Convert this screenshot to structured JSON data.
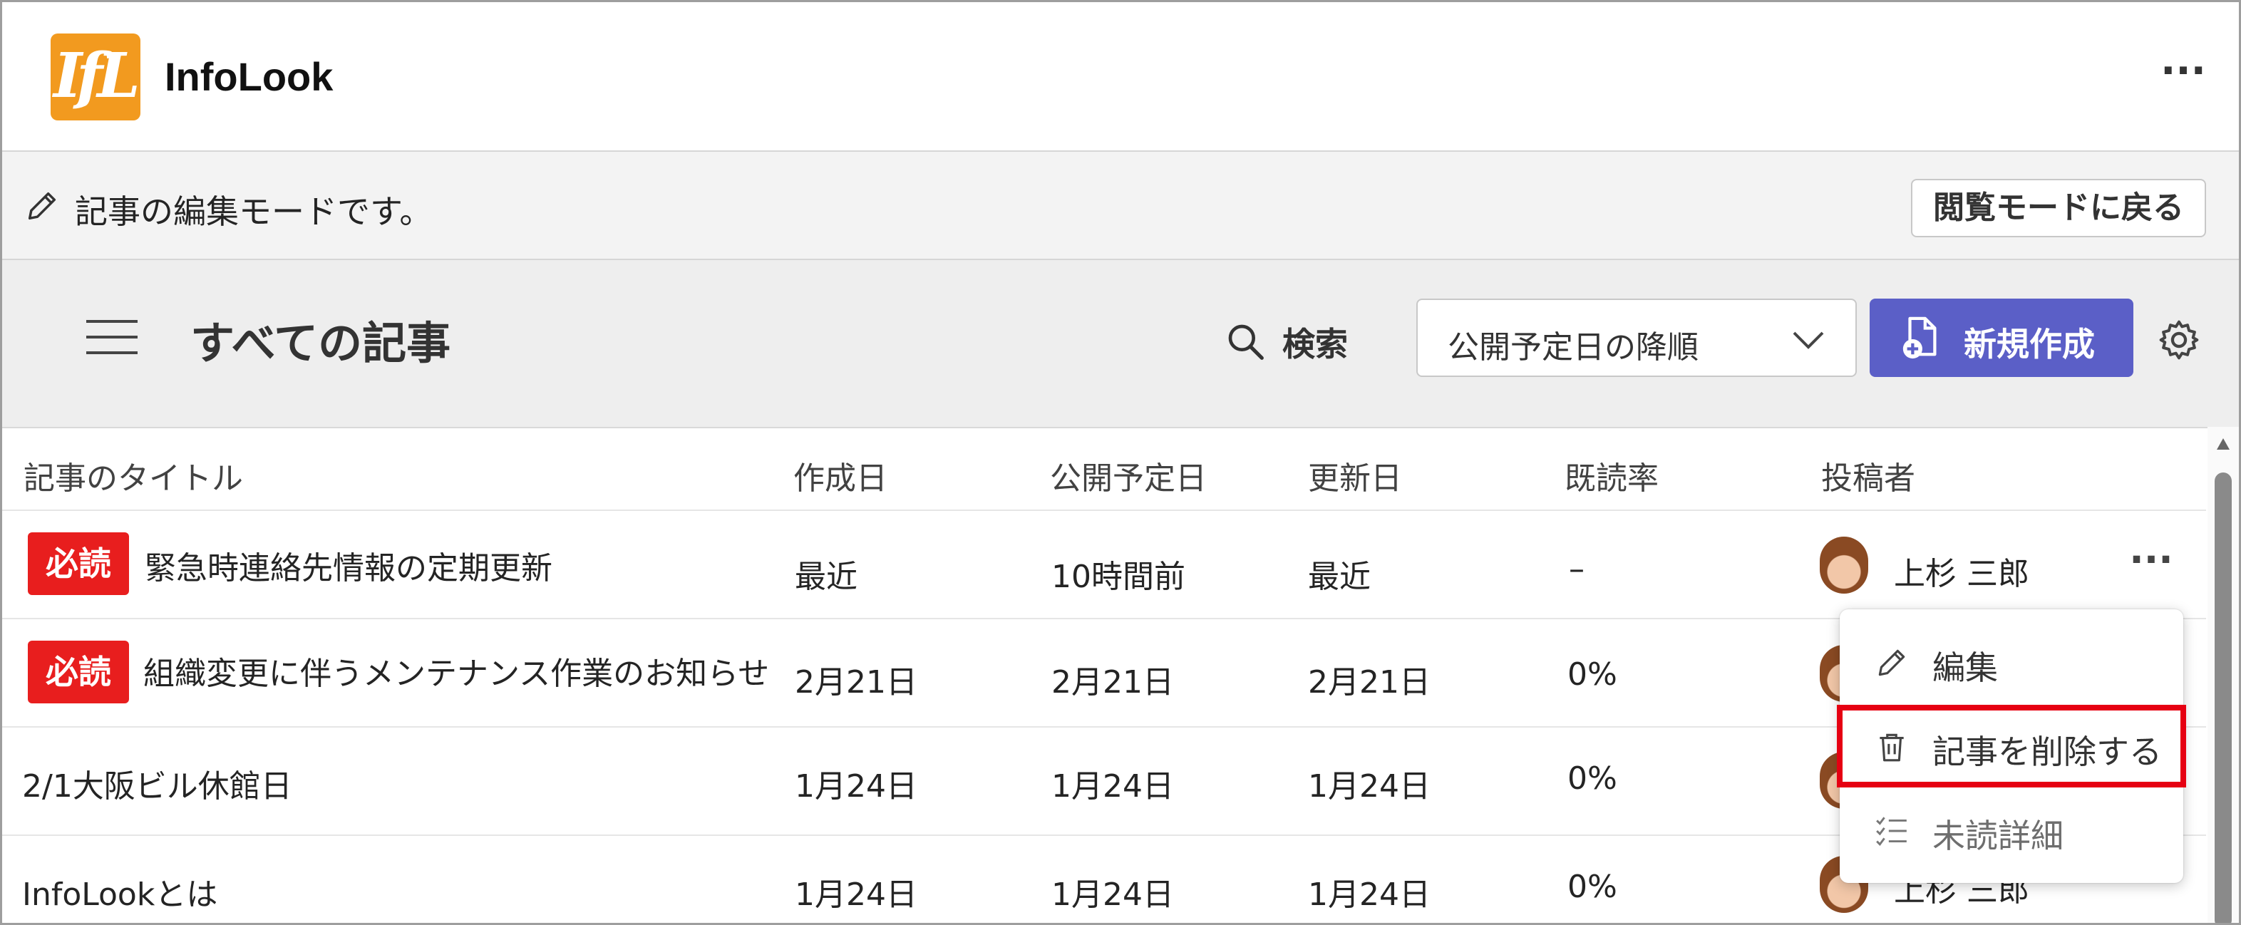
{
  "app": {
    "title": "InfoLook",
    "logo_text": "IfL",
    "more_label": "···"
  },
  "banner": {
    "text": "記事の編集モードです。",
    "back_button": "閲覧モードに戻る"
  },
  "toolbar": {
    "page_title": "すべての記事",
    "search_label": "検索",
    "sort_value": "公開予定日の降順",
    "new_button": "新規作成"
  },
  "table": {
    "columns": [
      "記事のタイトル",
      "作成日",
      "公開予定日",
      "更新日",
      "既読率",
      "投稿者"
    ],
    "rows": [
      {
        "badge": "必読",
        "title": "緊急時連絡先情報の定期更新",
        "created": "最近",
        "scheduled": "10時間前",
        "updated": "最近",
        "read_rate": "–",
        "author": "上杉 三郎"
      },
      {
        "badge": "必読",
        "title": "組織変更に伴うメンテナンス作業のお知らせ",
        "created": "2月21日",
        "scheduled": "2月21日",
        "updated": "2月21日",
        "read_rate": "0%",
        "author": ""
      },
      {
        "badge": "",
        "title": "2/1大阪ビル休館日",
        "created": "1月24日",
        "scheduled": "1月24日",
        "updated": "1月24日",
        "read_rate": "0%",
        "author": ""
      },
      {
        "badge": "",
        "title": "InfoLookとは",
        "created": "1月24日",
        "scheduled": "1月24日",
        "updated": "1月24日",
        "read_rate": "0%",
        "author": "上杉 三郎"
      }
    ]
  },
  "context_menu": {
    "items": [
      {
        "label": "編集",
        "icon": "pencil-icon"
      },
      {
        "label": "記事を削除する",
        "icon": "trash-icon"
      },
      {
        "label": "未読詳細",
        "icon": "checklist-icon"
      }
    ]
  },
  "colors": {
    "accent": "#5b5fc7",
    "badge": "#e81e1e",
    "highlight": "#e60012",
    "logo": "#f29a1f"
  }
}
